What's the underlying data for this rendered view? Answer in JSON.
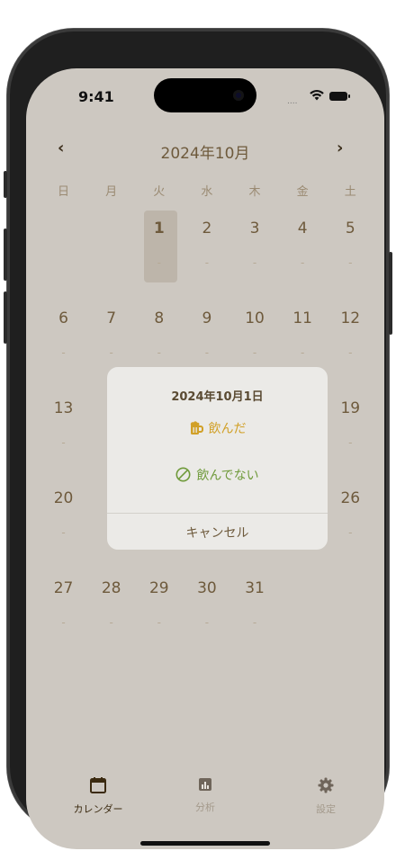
{
  "status_bar": {
    "time": "9:41",
    "signal": "....",
    "wifi_icon": "wifi-icon",
    "battery_icon": "battery-icon"
  },
  "calendar": {
    "prev_label": "‹",
    "next_label": "›",
    "month_title": "2024年10月",
    "weekdays": [
      "日",
      "月",
      "火",
      "水",
      "木",
      "金",
      "土"
    ],
    "weeks": [
      [
        {
          "day": "",
          "mark": ""
        },
        {
          "day": "",
          "mark": ""
        },
        {
          "day": "1",
          "mark": "-",
          "today": true
        },
        {
          "day": "2",
          "mark": "-"
        },
        {
          "day": "3",
          "mark": "-"
        },
        {
          "day": "4",
          "mark": "-"
        },
        {
          "day": "5",
          "mark": "-"
        }
      ],
      [
        {
          "day": "6",
          "mark": "-"
        },
        {
          "day": "7",
          "mark": "-"
        },
        {
          "day": "8",
          "mark": "-"
        },
        {
          "day": "9",
          "mark": "-"
        },
        {
          "day": "10",
          "mark": "-"
        },
        {
          "day": "11",
          "mark": "-"
        },
        {
          "day": "12",
          "mark": "-"
        }
      ],
      [
        {
          "day": "13",
          "mark": "-"
        },
        {
          "day": "",
          "mark": ""
        },
        {
          "day": "",
          "mark": ""
        },
        {
          "day": "",
          "mark": ""
        },
        {
          "day": "",
          "mark": ""
        },
        {
          "day": "",
          "mark": ""
        },
        {
          "day": "19",
          "mark": "-"
        }
      ],
      [
        {
          "day": "20",
          "mark": "-"
        },
        {
          "day": "",
          "mark": ""
        },
        {
          "day": "",
          "mark": ""
        },
        {
          "day": "",
          "mark": ""
        },
        {
          "day": "",
          "mark": ""
        },
        {
          "day": "",
          "mark": ""
        },
        {
          "day": "26",
          "mark": "-"
        }
      ],
      [
        {
          "day": "27",
          "mark": "-"
        },
        {
          "day": "28",
          "mark": "-"
        },
        {
          "day": "29",
          "mark": "-"
        },
        {
          "day": "30",
          "mark": "-"
        },
        {
          "day": "31",
          "mark": "-"
        },
        {
          "day": "",
          "mark": ""
        },
        {
          "day": "",
          "mark": ""
        }
      ]
    ]
  },
  "dialog": {
    "title": "2024年10月1日",
    "drank_label": "飲んだ",
    "drank_icon": "beer-mug-icon",
    "not_drank_label": "飲んでない",
    "not_drank_icon": "prohibited-icon",
    "cancel_label": "キャンセル"
  },
  "tabbar": {
    "tabs": [
      {
        "label": "カレンダー",
        "icon": "calendar-icon",
        "active": true
      },
      {
        "label": "分析",
        "icon": "chart-icon",
        "active": false
      },
      {
        "label": "設定",
        "icon": "gear-icon",
        "active": false
      }
    ]
  },
  "colors": {
    "background": "#cdc8c1",
    "accent_text": "#6e5a3c",
    "drank": "#d1a027",
    "not_drank": "#6f9a3a",
    "dialog_bg": "#ebeae7"
  }
}
